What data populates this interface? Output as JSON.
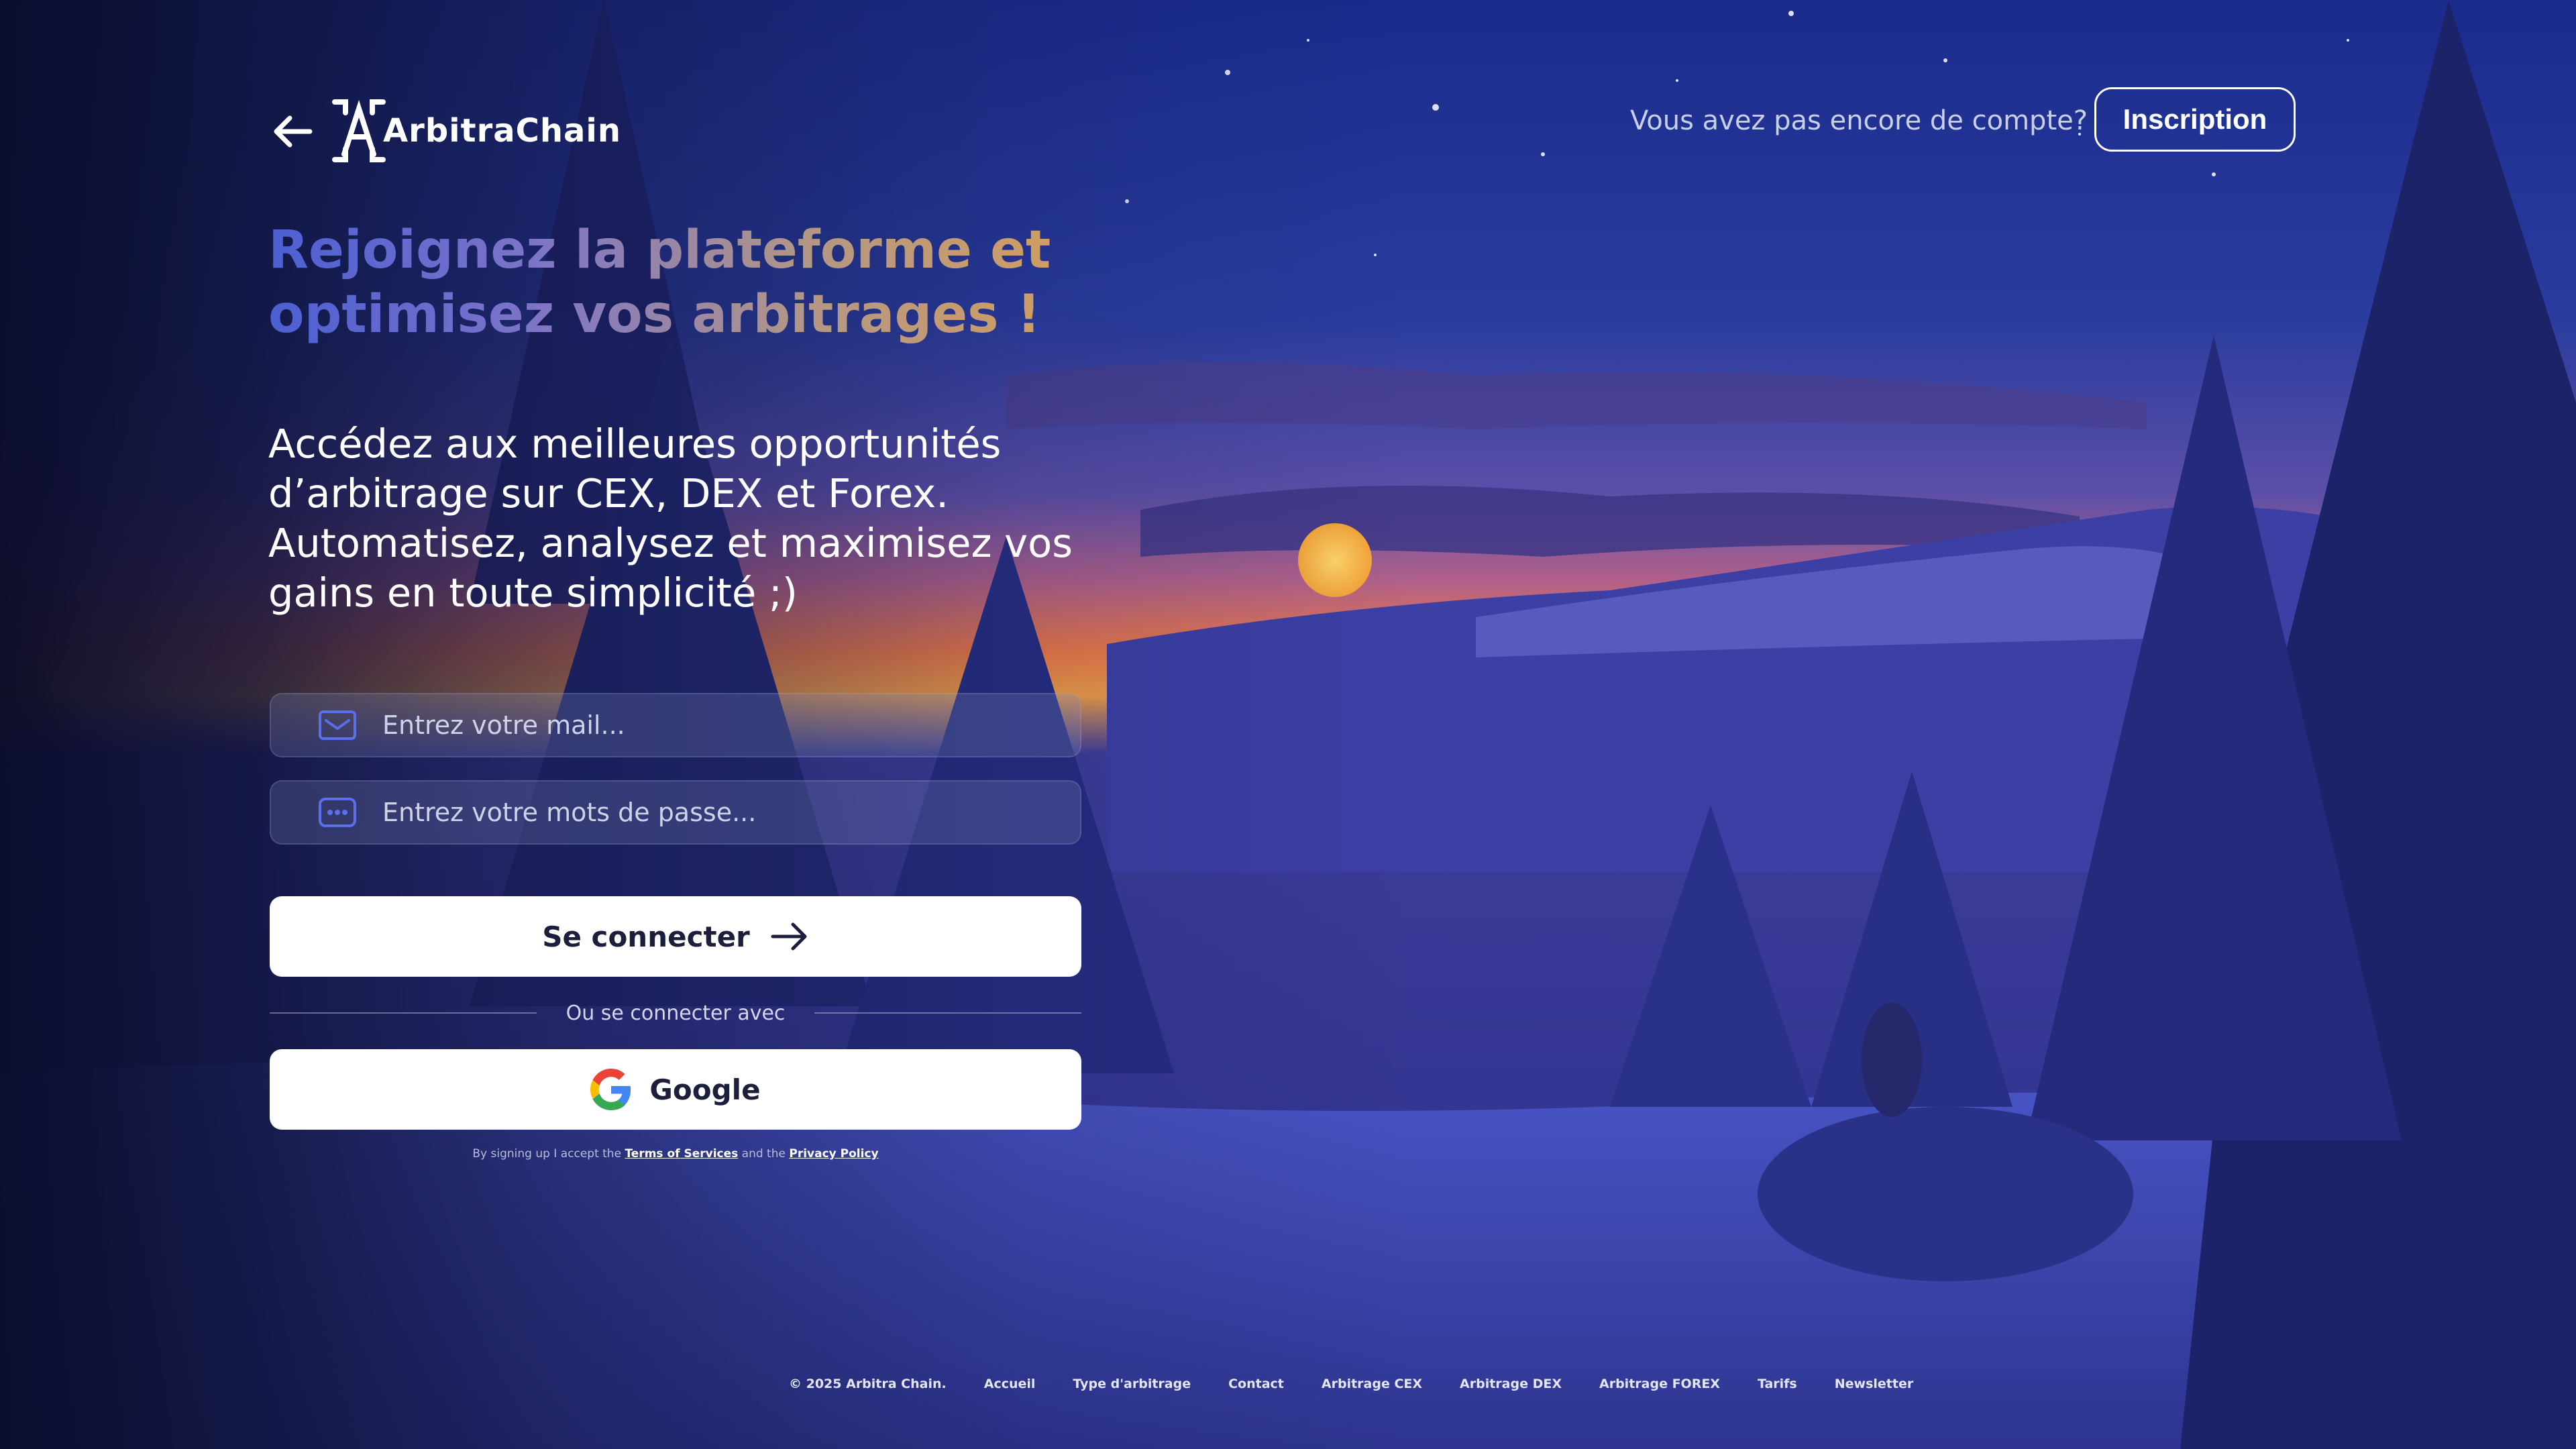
{
  "brand": {
    "name": "ArbitraChain"
  },
  "header": {
    "signup_prompt": "Vous avez pas encore de compte?",
    "signup_label": "Inscription"
  },
  "hero": {
    "title_line1": "Rejoignez la plateforme et",
    "title_line2": "optimisez vos arbitrages !",
    "sub_line1": "Accédez aux meilleures opportunités",
    "sub_line2": "d’arbitrage sur CEX, DEX et Forex.",
    "sub_line3": "Automatisez, analysez et maximisez vos",
    "sub_line4": "gains en toute simplicité ;)"
  },
  "form": {
    "email_placeholder": "Entrez votre mail...",
    "password_placeholder": "Entrez votre mots de passe...",
    "submit_label": "Se connecter",
    "divider_text": "Ou se connecter avec",
    "google_label": "Google",
    "legal_prefix": "By signing up I accept the",
    "legal_terms": "Terms of Services",
    "legal_and": "and the",
    "legal_privacy": "Privacy Policy"
  },
  "footer": {
    "copyright": "© 2025 Arbitra Chain.",
    "links": [
      "Accueil",
      "Type d'arbitrage",
      "Contact",
      "Arbitrage CEX",
      "Arbitrage DEX",
      "Arbitrage FOREX",
      "Tarifs",
      "Newsletter"
    ]
  },
  "icons": {
    "back": "arrow-left-icon",
    "logo": "arbitrachain-logo-icon",
    "email": "mail-icon",
    "password": "password-dots-icon",
    "submit": "arrow-right-icon",
    "google": "google-icon"
  },
  "colors": {
    "background_sky": "#1c2a86",
    "title_gradient_start": "#4b5fd3",
    "title_gradient_end": "#d9a058",
    "button_bg": "#ffffff",
    "button_text": "#1b1f3b"
  }
}
